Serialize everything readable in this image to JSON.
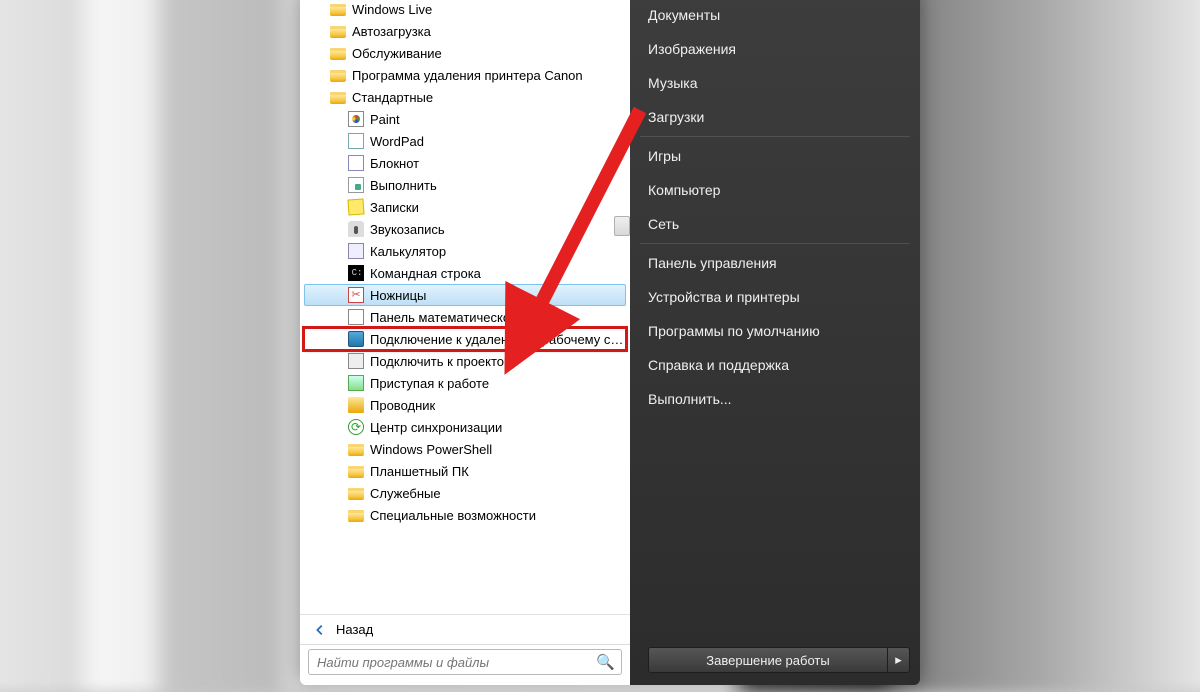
{
  "programs": {
    "folders_top": [
      "Windows Live",
      "Автозагрузка",
      "Обслуживание",
      "Программа удаления принтера Canon",
      "Стандартные"
    ],
    "accessories": [
      {
        "label": "Paint",
        "icon": "paint"
      },
      {
        "label": "WordPad",
        "icon": "wordpad"
      },
      {
        "label": "Блокнот",
        "icon": "note"
      },
      {
        "label": "Выполнить",
        "icon": "run"
      },
      {
        "label": "Записки",
        "icon": "sticky"
      },
      {
        "label": "Звукозапись",
        "icon": "mic"
      },
      {
        "label": "Калькулятор",
        "icon": "calc"
      },
      {
        "label": "Командная строка",
        "icon": "cmd"
      },
      {
        "label": "Ножницы",
        "icon": "snip",
        "selected": true
      },
      {
        "label": "Панель математического ввода",
        "icon": "math"
      },
      {
        "label": "Подключение к удаленному рабочему стол",
        "icon": "rdp",
        "highlight": true
      },
      {
        "label": "Подключить к проектору",
        "icon": "proj"
      },
      {
        "label": "Приступая к работе",
        "icon": "start"
      },
      {
        "label": "Проводник",
        "icon": "explorer"
      },
      {
        "label": "Центр синхронизации",
        "icon": "sync"
      }
    ],
    "folders_bottom": [
      "Windows PowerShell",
      "Планшетный ПК",
      "Служебные",
      "Специальные возможности"
    ],
    "back": "Назад",
    "search_placeholder": "Найти программы и файлы"
  },
  "right": {
    "items_top": [
      "Документы",
      "Изображения",
      "Музыка",
      "Загрузки"
    ],
    "items_mid": [
      "Игры",
      "Компьютер",
      "Сеть"
    ],
    "items_bot": [
      "Панель управления",
      "Устройства и принтеры",
      "Программы по умолчанию",
      "Справка и поддержка",
      "Выполнить..."
    ],
    "shutdown": "Завершение работы"
  }
}
